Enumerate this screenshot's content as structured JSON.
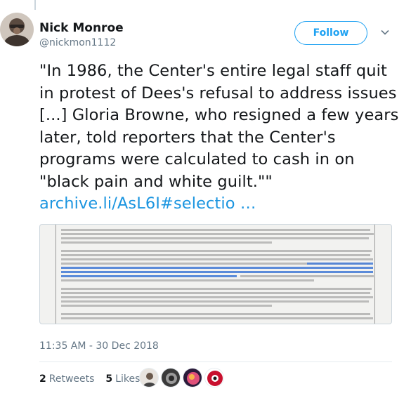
{
  "author": {
    "display_name": "Nick Monroe",
    "handle": "@nickmon1112",
    "avatar_icon": "avatar-portrait"
  },
  "follow_button": {
    "label": "Follow",
    "color": "#1da1f2"
  },
  "tweet": {
    "text": "\"In 1986, the Center's entire legal staff quit in protest of Dees's refusal to address issues [...] Gloria Browne, who resigned a few years later, told reporters that the Center's programs were calculated to cash in on \"black pain and white guilt.\"\"",
    "link_text": "archive.li/AsL6I#selectio …",
    "link_color": "#1b95e0"
  },
  "media": {
    "description_icon": "document-screenshot-image",
    "highlight_color": "#4a7fd6"
  },
  "timestamp": "11:35 AM - 30 Dec 2018",
  "stats": {
    "retweets_count": "2",
    "retweets_label": "Retweets",
    "likes_count": "5",
    "likes_label": "Likes",
    "likers": [
      "liker-avatar-1",
      "liker-avatar-2",
      "liker-avatar-3",
      "liker-avatar-4"
    ]
  }
}
